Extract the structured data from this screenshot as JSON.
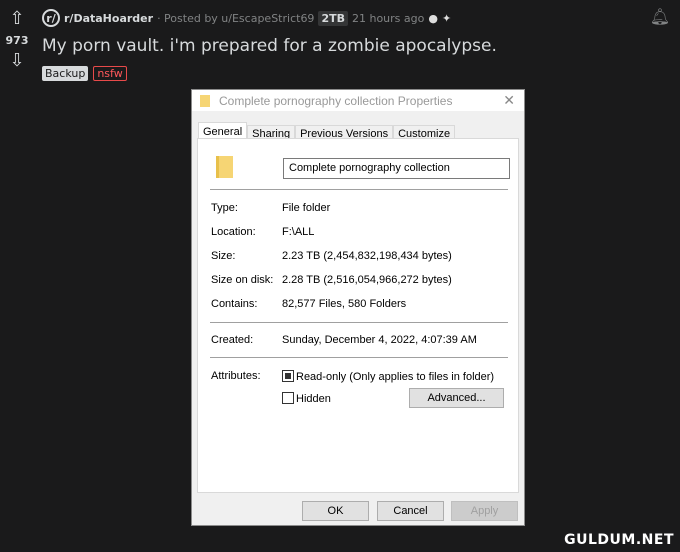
{
  "post": {
    "score": "973",
    "subreddit": "r/DataHoarder",
    "posted_by": "· Posted by u/EscapeStrict69",
    "user_flair": "2TB",
    "time": "21 hours ago",
    "title": "My porn vault. i'm prepared for a zombie apocalypse.",
    "tags": [
      "Backup",
      "nsfw"
    ]
  },
  "dialog": {
    "title": "Complete pornography collection Properties",
    "tabs": [
      "General",
      "Sharing",
      "Previous Versions",
      "Customize"
    ],
    "name": "Complete pornography collection",
    "rows": [
      {
        "label": "Type:",
        "value": "File folder"
      },
      {
        "label": "Location:",
        "value": "F:\\ALL"
      },
      {
        "label": "Size:",
        "value": "2.23 TB (2,454,832,198,434 bytes)"
      },
      {
        "label": "Size on disk:",
        "value": "2.28 TB (2,516,054,966,272 bytes)"
      },
      {
        "label": "Contains:",
        "value": "82,577 Files, 580 Folders"
      },
      {
        "label": "Created:",
        "value": "Sunday, December 4, 2022, 4:07:39 AM"
      }
    ],
    "attributes_label": "Attributes:",
    "readonly_label": "Read-only (Only applies to files in folder)",
    "readonly_state": "indeterminate",
    "hidden_label": "Hidden",
    "hidden_checked": false,
    "advanced_label": "Advanced...",
    "ok_label": "OK",
    "cancel_label": "Cancel",
    "apply_label": "Apply"
  },
  "watermark": "GULDUM.NET"
}
